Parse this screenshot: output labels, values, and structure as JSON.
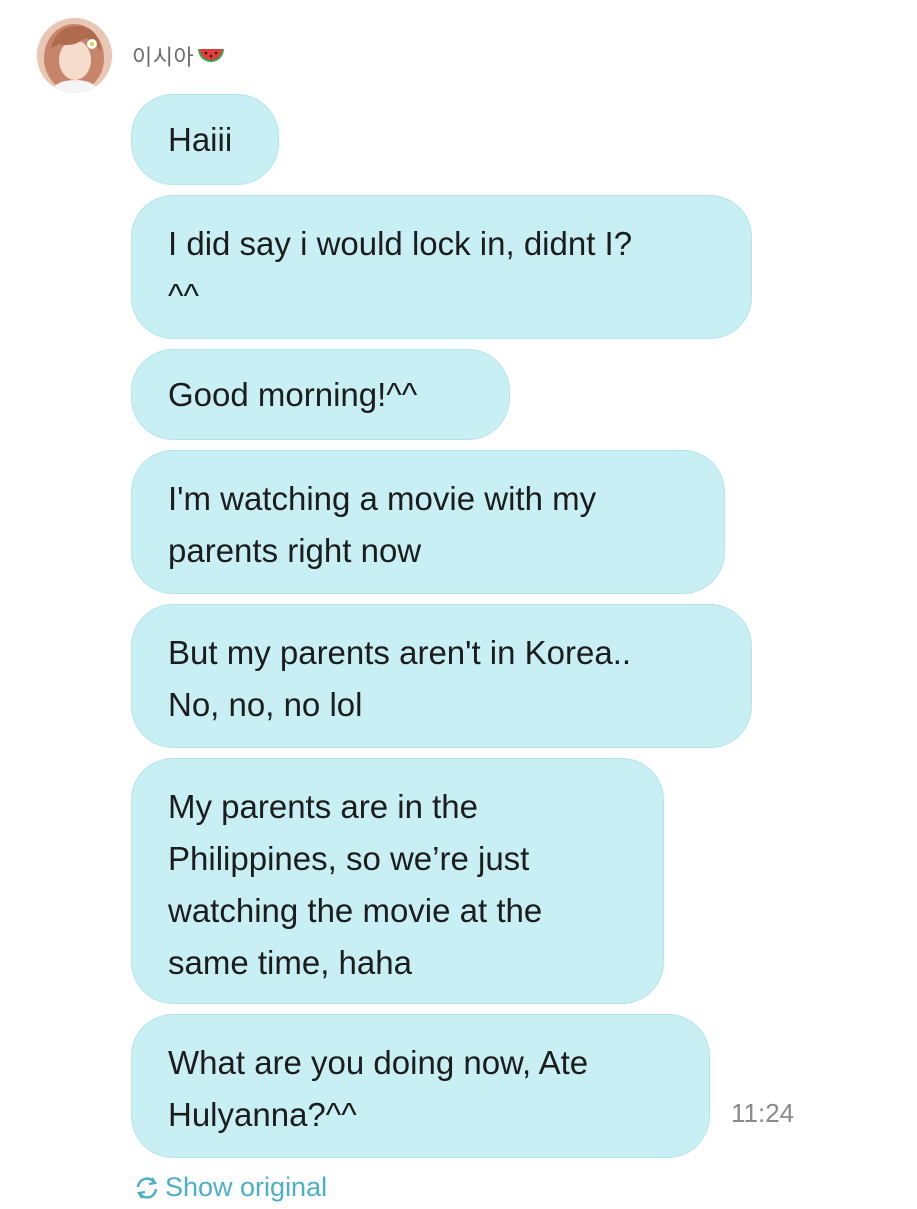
{
  "chat": {
    "sender": {
      "name": "이시아",
      "name_emoji_icon": "watermelon-icon",
      "avatar_icon": "profile-avatar"
    },
    "messages": [
      {
        "text": "Haiii"
      },
      {
        "text": "I did say i would lock in, didnt I?\n^^"
      },
      {
        "text": "Good morning!^^"
      },
      {
        "text": "I'm watching a movie with my\nparents right now"
      },
      {
        "text": "But my parents aren't in Korea..\nNo, no, no lol"
      },
      {
        "text": "My parents are in the\nPhilippines, so we’re just\nwatching the movie at the\nsame time, haha"
      },
      {
        "text": "What are you doing now, Ate\nHulyanna?^^"
      }
    ],
    "timestamp": "11:24",
    "show_original_label": "Show original",
    "show_original_icon": "translate-icon"
  },
  "colors": {
    "bubble_bg": "#c8f0f4",
    "bubble_border": "#b4e4ea",
    "text": "#1c1c1c",
    "timestamp": "#8a8a8a",
    "link_accent": "#4ab0c8"
  }
}
